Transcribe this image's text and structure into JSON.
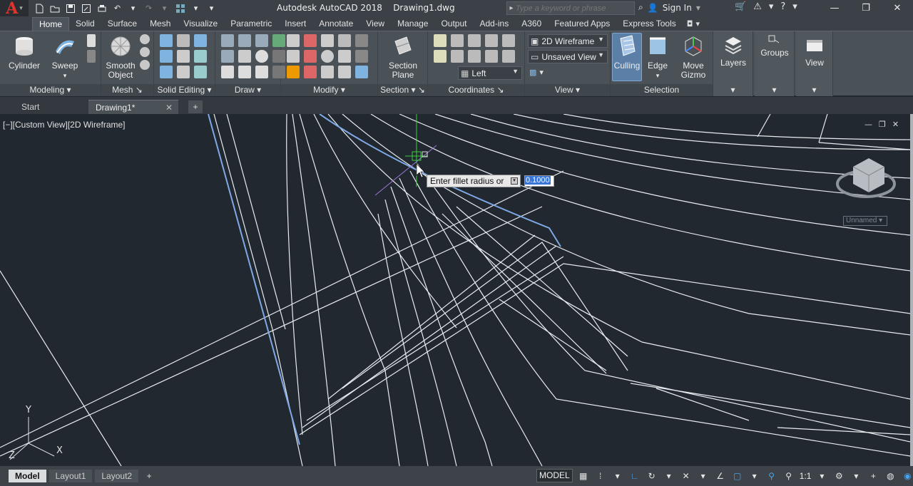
{
  "titlebar": {
    "app_title": "Autodesk AutoCAD 2018",
    "doc_title": "Drawing1.dwg",
    "search_placeholder": "Type a keyword or phrase",
    "signin": "Sign In"
  },
  "ribbon_tabs": [
    "Home",
    "Solid",
    "Surface",
    "Mesh",
    "Visualize",
    "Parametric",
    "Insert",
    "Annotate",
    "View",
    "Manage",
    "Output",
    "Add-ins",
    "A360",
    "Featured Apps",
    "Express Tools"
  ],
  "ribbon": {
    "cylinder": "Cylinder",
    "sweep": "Sweep",
    "smooth_object_1": "Smooth",
    "smooth_object_2": "Object",
    "section_plane_1": "Section",
    "section_plane_2": "Plane",
    "visual_style": "2D Wireframe",
    "named_view": "Unsaved View",
    "ucs_view": "Left",
    "culling": "Culling",
    "edge": "Edge",
    "move_gizmo_1": "Move",
    "move_gizmo_2": "Gizmo",
    "layers": "Layers",
    "groups": "Groups",
    "view_btn": "View",
    "panels": {
      "modeling": "Modeling",
      "mesh": "Mesh",
      "solid_editing": "Solid Editing",
      "draw": "Draw",
      "modify": "Modify",
      "section": "Section",
      "coordinates": "Coordinates",
      "view": "View",
      "selection": "Selection"
    }
  },
  "file_tabs": {
    "start": "Start",
    "drawing": "Drawing1*"
  },
  "viewport": {
    "label": "[−][Custom View][2D Wireframe]",
    "prompt": "Enter fillet radius or",
    "input_value": "0.1000",
    "named_ucs": "Unnamed",
    "ucs_x": "X",
    "ucs_y": "Y",
    "ucs_z": "Z"
  },
  "status": {
    "layout_tabs": [
      "Model",
      "Layout1",
      "Layout2"
    ],
    "model_button": "MODEL",
    "scale": "1:1"
  },
  "colors": {
    "viewport_bg": "#212830",
    "ribbon_bg": "#4a5157",
    "highlight_blue": "#5b7fa6",
    "logo_red": "#e0342c"
  }
}
